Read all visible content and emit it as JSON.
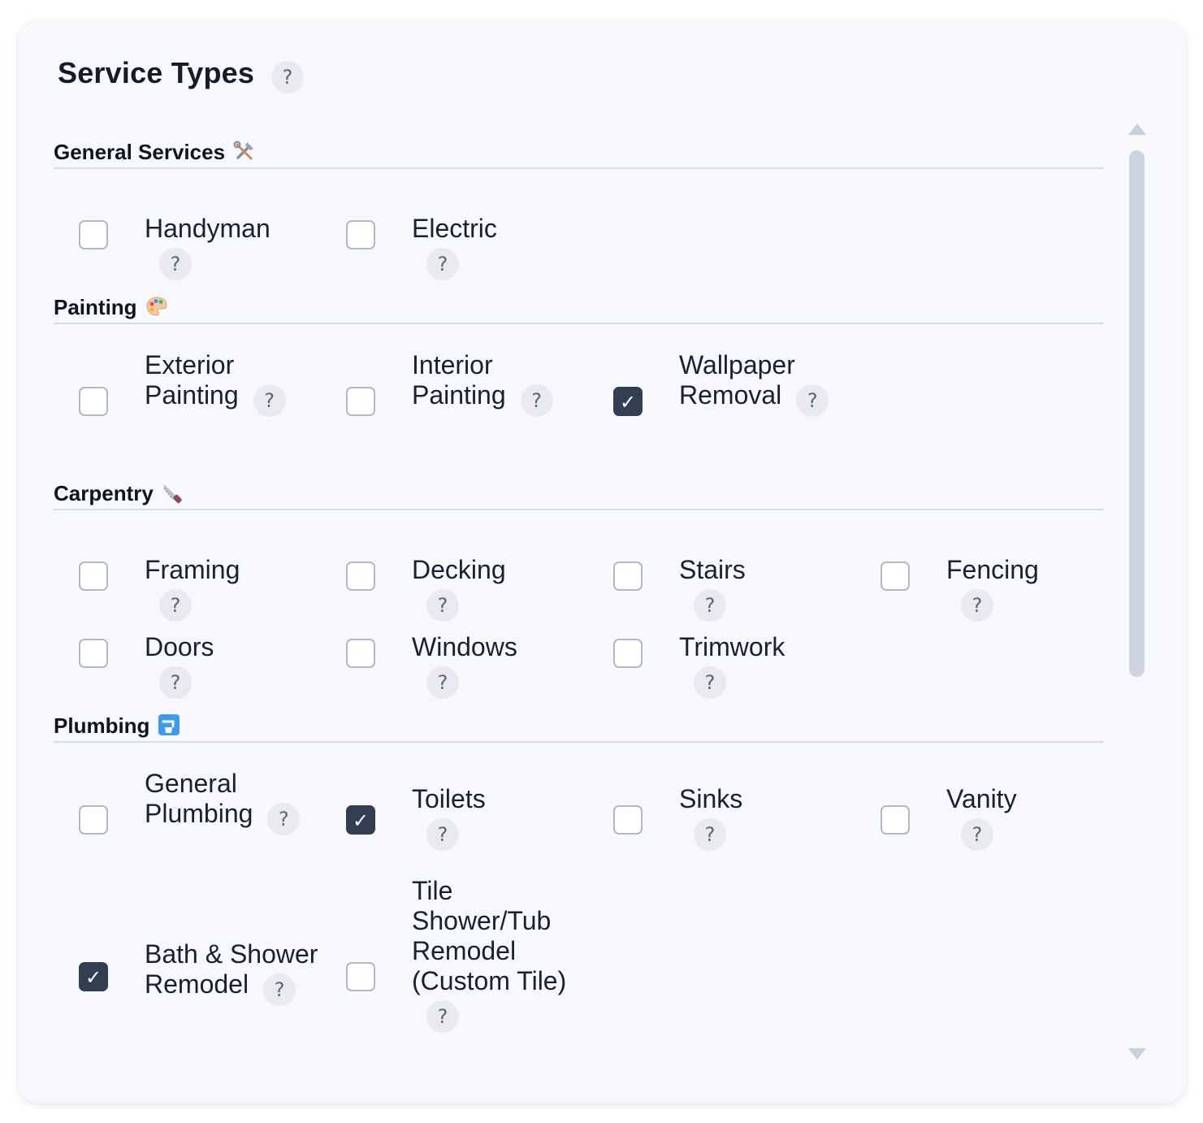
{
  "panel": {
    "title": "Service Types",
    "help": "?"
  },
  "sections": [
    {
      "title": "General Services",
      "icon": "hammer-and-wrench-icon",
      "items": [
        {
          "label": "Handyman",
          "checked": false
        },
        {
          "label": "Electric",
          "checked": false
        }
      ]
    },
    {
      "title": "Painting",
      "icon": "artist-palette-icon",
      "items": [
        {
          "label": "Exterior Painting",
          "checked": false
        },
        {
          "label": "Interior Painting",
          "checked": false
        },
        {
          "label": "Wallpaper Removal",
          "checked": true
        }
      ]
    },
    {
      "title": "Carpentry",
      "icon": "carpentry-saw-icon",
      "items": [
        {
          "label": "Framing",
          "checked": false
        },
        {
          "label": "Decking",
          "checked": false
        },
        {
          "label": "Stairs",
          "checked": false
        },
        {
          "label": "Fencing",
          "checked": false
        },
        {
          "label": "Doors",
          "checked": false
        },
        {
          "label": "Windows",
          "checked": false
        },
        {
          "label": "Trimwork",
          "checked": false
        }
      ]
    },
    {
      "title": "Plumbing",
      "icon": "potable-water-icon",
      "items": [
        {
          "label": "General Plumbing",
          "checked": false
        },
        {
          "label": "Toilets",
          "checked": true
        },
        {
          "label": "Sinks",
          "checked": false
        },
        {
          "label": "Vanity",
          "checked": false
        },
        {
          "label": "Bath & Shower Remodel",
          "checked": true
        },
        {
          "label": "Tile Shower/Tub Remodel (Custom Tile)",
          "checked": false
        }
      ]
    }
  ],
  "colors": {
    "checked": "#333e53",
    "panel_bg": "#f7f8fc",
    "help_bg": "#e8eaef"
  }
}
